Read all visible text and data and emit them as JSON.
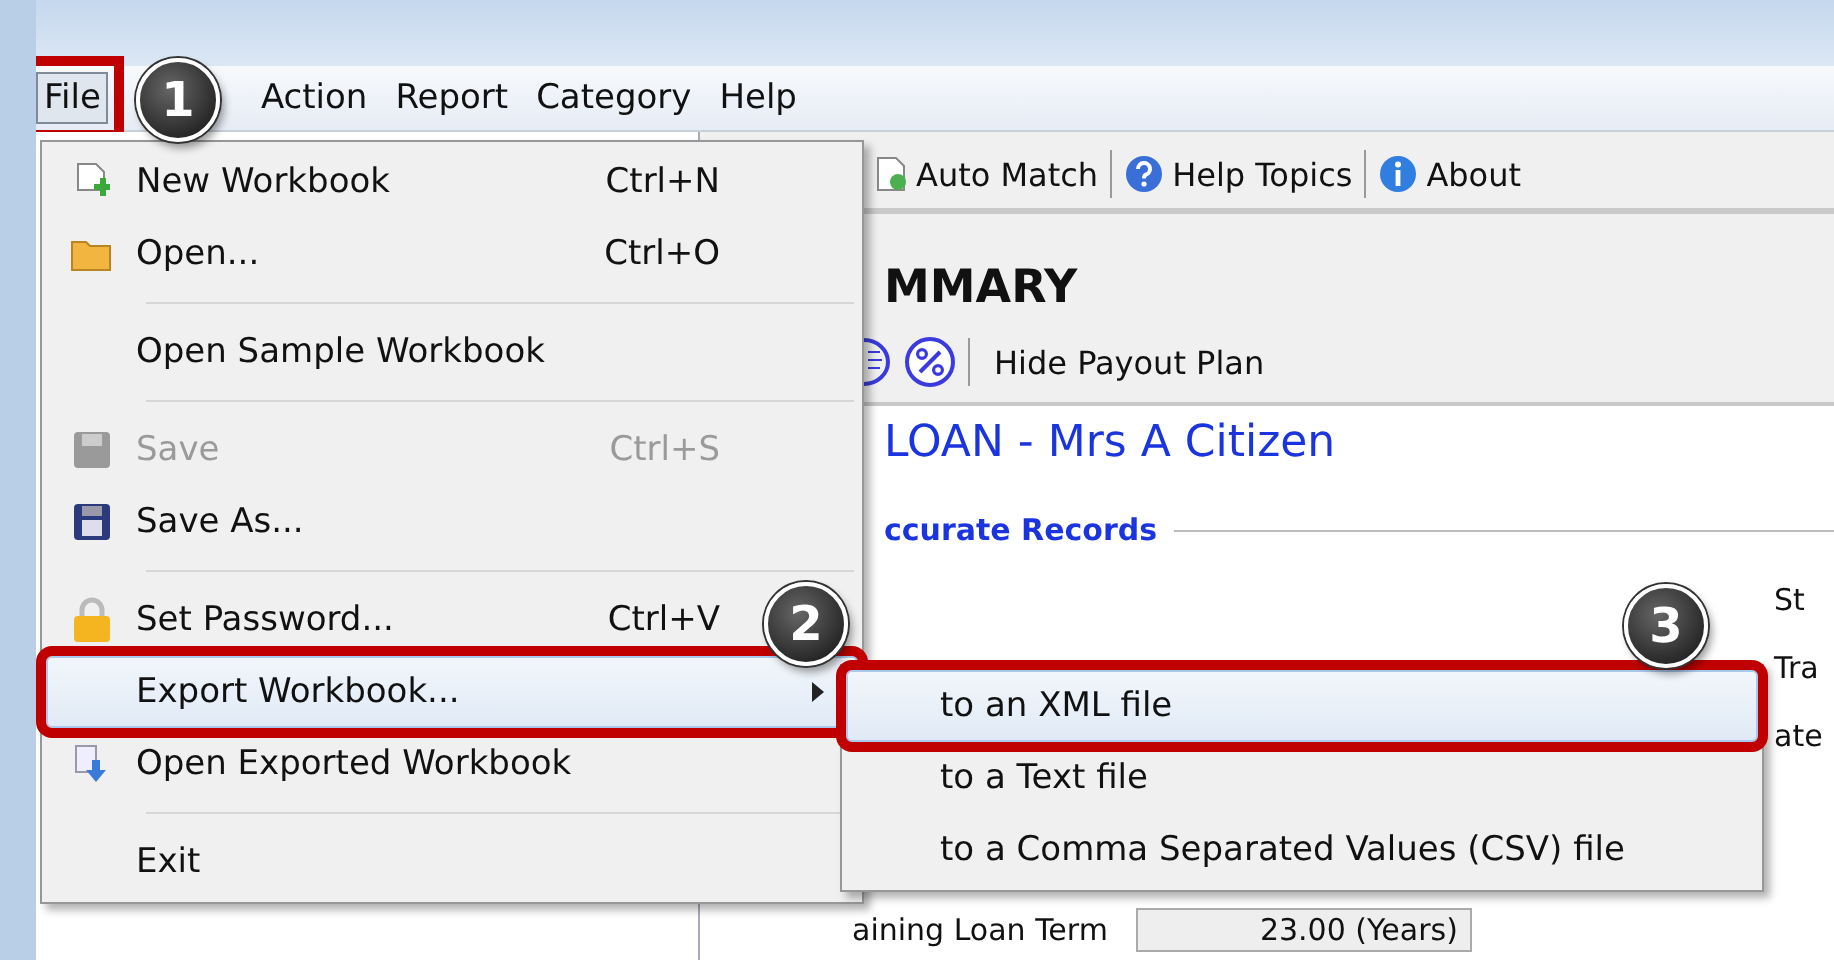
{
  "menubar": [
    {
      "label": "File",
      "selected": true
    },
    {
      "label": "Action",
      "selected": false
    },
    {
      "label": "Report",
      "selected": false
    },
    {
      "label": "Category",
      "selected": false
    },
    {
      "label": "Help",
      "selected": false
    }
  ],
  "toolbar": [
    {
      "label": "Auto Match"
    },
    {
      "label": "Help Topics"
    },
    {
      "label": "About"
    }
  ],
  "summary": {
    "heading": "MMARY",
    "action": "Hide Payout Plan",
    "loan_title": "LOAN - Mrs A Citizen",
    "section": "ccurate Records",
    "edge_labels": [
      "St",
      "Tra",
      "ate"
    ],
    "term_label": "aining Loan Term",
    "term_value": "23.00 (Years)"
  },
  "file_menu": [
    {
      "kind": "item",
      "label": "New Workbook",
      "shortcut": "Ctrl+N",
      "disabled": false,
      "selected": false
    },
    {
      "kind": "item",
      "label": "Open...",
      "shortcut": "Ctrl+O",
      "disabled": false,
      "selected": false
    },
    {
      "kind": "separator"
    },
    {
      "kind": "item",
      "label": "Open Sample Workbook",
      "disabled": false,
      "selected": false
    },
    {
      "kind": "separator"
    },
    {
      "kind": "item",
      "label": "Save",
      "shortcut": "Ctrl+S",
      "disabled": true,
      "selected": false
    },
    {
      "kind": "item",
      "label": "Save As...",
      "disabled": false,
      "selected": false
    },
    {
      "kind": "separator"
    },
    {
      "kind": "item",
      "label": "Set Password...",
      "shortcut": "Ctrl+V",
      "disabled": false,
      "selected": false
    },
    {
      "kind": "submenu",
      "label": "Export Workbook...",
      "disabled": false,
      "selected": true
    },
    {
      "kind": "item",
      "label": "Open Exported Workbook",
      "disabled": false,
      "selected": false
    },
    {
      "kind": "separator"
    },
    {
      "kind": "item",
      "label": "Exit",
      "disabled": false,
      "selected": false
    }
  ],
  "export_submenu": [
    {
      "label": "to an XML file",
      "selected": true
    },
    {
      "label": "to a Text file",
      "selected": false
    },
    {
      "label": "to a Comma Separated Values (CSV) file",
      "selected": false
    }
  ],
  "callouts": [
    "1",
    "2",
    "3"
  ]
}
